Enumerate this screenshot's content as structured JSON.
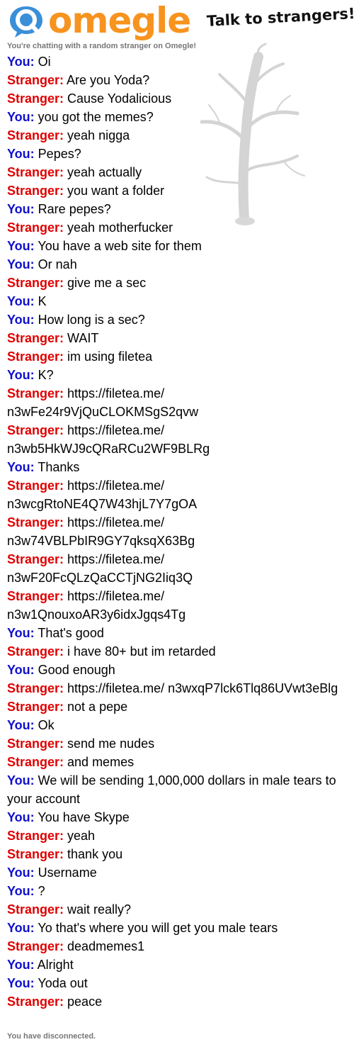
{
  "header": {
    "logo_text": "omegle",
    "tagline": "Talk to strangers!",
    "status_top": "You're chatting with a random stranger on Omegle!"
  },
  "labels": {
    "you": "You:",
    "stranger": "Stranger:"
  },
  "colors": {
    "you": "#1010cc",
    "stranger": "#e00000",
    "logo": "#f7931e",
    "logo_bubble": "#3a8fd9"
  },
  "messages": [
    {
      "from": "you",
      "text": "Oi"
    },
    {
      "from": "stranger",
      "text": "Are you Yoda?"
    },
    {
      "from": "stranger",
      "text": "Cause Yodalicious"
    },
    {
      "from": "you",
      "text": "you got the memes?"
    },
    {
      "from": "stranger",
      "text": "yeah nigga"
    },
    {
      "from": "you",
      "text": "Pepes?"
    },
    {
      "from": "stranger",
      "text": "yeah actually"
    },
    {
      "from": "stranger",
      "text": "you want a folder"
    },
    {
      "from": "you",
      "text": "Rare pepes?"
    },
    {
      "from": "stranger",
      "text": "yeah motherfucker"
    },
    {
      "from": "you",
      "text": "You have a web site for them"
    },
    {
      "from": "you",
      "text": "Or nah"
    },
    {
      "from": "stranger",
      "text": "give me a sec"
    },
    {
      "from": "you",
      "text": "K"
    },
    {
      "from": "you",
      "text": "How long is a sec?"
    },
    {
      "from": "stranger",
      "text": "WAIT"
    },
    {
      "from": "stranger",
      "text": "im using filetea"
    },
    {
      "from": "you",
      "text": "K?"
    },
    {
      "from": "stranger",
      "text": "https://filetea.me/ n3wFe24r9VjQuCLOKMSgS2qvw"
    },
    {
      "from": "stranger",
      "text": "https://filetea.me/ n3wb5HkWJ9cQRaRCu2WF9BLRg"
    },
    {
      "from": "you",
      "text": "Thanks"
    },
    {
      "from": "stranger",
      "text": "https://filetea.me/ n3wcgRtoNE4Q7W43hjL7Y7gOA"
    },
    {
      "from": "stranger",
      "text": "https://filetea.me/ n3w74VBLPbIR9GY7qksqX63Bg"
    },
    {
      "from": "stranger",
      "text": "https://filetea.me/ n3wF20FcQLzQaCCTjNG2Iiq3Q"
    },
    {
      "from": "stranger",
      "text": "https://filetea.me/ n3w1QnouxoAR3y6idxJgqs4Tg"
    },
    {
      "from": "you",
      "text": "That's good"
    },
    {
      "from": "stranger",
      "text": "i have 80+ but im retarded"
    },
    {
      "from": "you",
      "text": "Good enough"
    },
    {
      "from": "stranger",
      "text": "https://filetea.me/ n3wxqP7lck6Tlq86UVwt3eBlg"
    },
    {
      "from": "stranger",
      "text": "not a pepe"
    },
    {
      "from": "you",
      "text": "Ok"
    },
    {
      "from": "stranger",
      "text": "send me nudes"
    },
    {
      "from": "stranger",
      "text": "and memes"
    },
    {
      "from": "you",
      "text": "We will be sending 1,000,000 dollars in male tears to your account"
    },
    {
      "from": "you",
      "text": "You have Skype"
    },
    {
      "from": "stranger",
      "text": "yeah"
    },
    {
      "from": "stranger",
      "text": "thank you"
    },
    {
      "from": "you",
      "text": "Username"
    },
    {
      "from": "you",
      "text": "?"
    },
    {
      "from": "stranger",
      "text": "wait really?"
    },
    {
      "from": "you",
      "text": "Yo that's where you will get you male tears"
    },
    {
      "from": "stranger",
      "text": "deadmemes1"
    },
    {
      "from": "you",
      "text": "Alright"
    },
    {
      "from": "you",
      "text": "Yoda out"
    },
    {
      "from": "stranger",
      "text": "peace"
    }
  ],
  "status_bottom": "You have disconnected."
}
